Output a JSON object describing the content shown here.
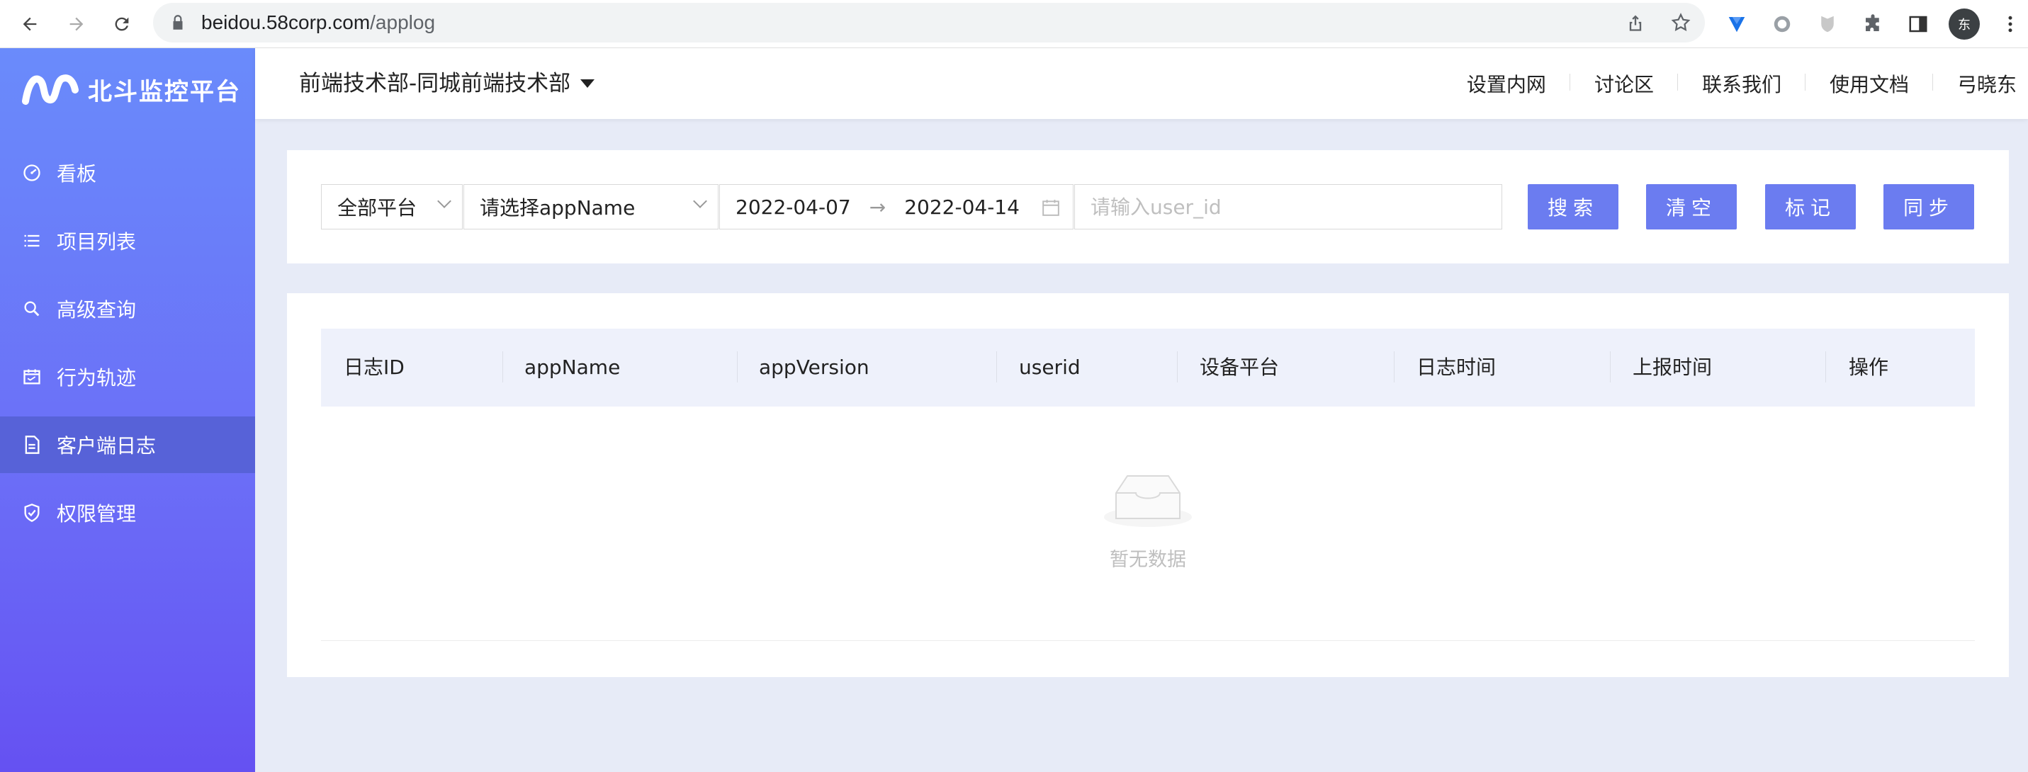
{
  "browser": {
    "url_domain": "beidou.58corp.com",
    "url_path": "/applog",
    "profile_initial": "东"
  },
  "sidebar": {
    "logo_text": "北斗监控平台",
    "items": [
      {
        "label": "看板",
        "icon": "dashboard-icon"
      },
      {
        "label": "项目列表",
        "icon": "list-icon"
      },
      {
        "label": "高级查询",
        "icon": "search-icon"
      },
      {
        "label": "行为轨迹",
        "icon": "calendar-icon"
      },
      {
        "label": "客户端日志",
        "icon": "file-icon",
        "active": true
      },
      {
        "label": "权限管理",
        "icon": "shield-check-icon"
      }
    ]
  },
  "header": {
    "department": "前端技术部-同城前端技术部",
    "links": [
      "设置内网",
      "讨论区",
      "联系我们",
      "使用文档",
      "弓晓东"
    ]
  },
  "filters": {
    "platform": "全部平台",
    "app_name_placeholder": "请选择appName",
    "date_start": "2022-04-07",
    "date_separator": "→",
    "date_end": "2022-04-14",
    "user_id_placeholder": "请输入user_id"
  },
  "buttons": {
    "search": "搜索",
    "clear": "清空",
    "mark": "标记",
    "sync": "同步"
  },
  "table": {
    "columns": [
      "日志ID",
      "appName",
      "appVersion",
      "userid",
      "设备平台",
      "日志时间",
      "上报时间",
      "操作"
    ],
    "rows": [],
    "empty_text": "暂无数据"
  },
  "colors": {
    "accent": "#6b7cf0",
    "sidebar_top": "#6a8bfb",
    "sidebar_bottom": "#6551f2",
    "active_item": "#5762d8"
  }
}
